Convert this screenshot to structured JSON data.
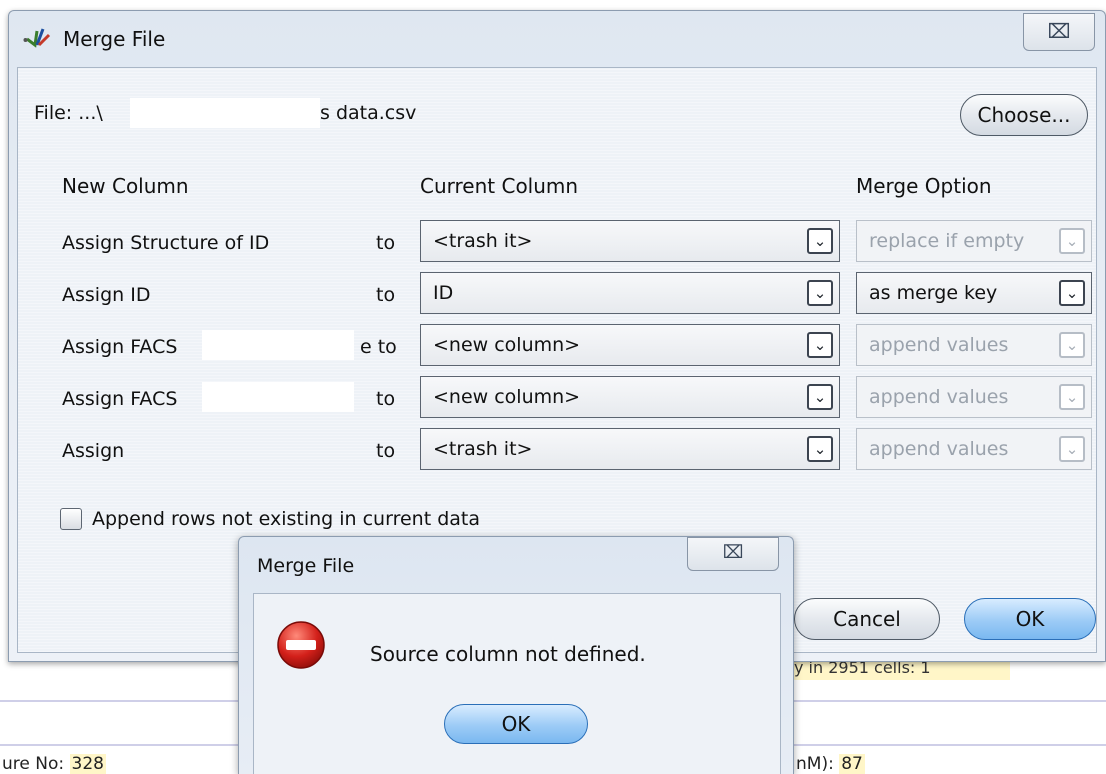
{
  "background": {
    "status_left_label": "ure No:",
    "status_left_value": "328",
    "status_right_label": "nM):",
    "status_right_value": "87",
    "cells_fragment": "y in 2951 cells: 1"
  },
  "dialog": {
    "title": "Merge File",
    "close_glyph": "⌧",
    "file_label": "File: ...\\",
    "file_suffix": "s data.csv",
    "choose_label": "Choose...",
    "headers": {
      "new_column": "New Column",
      "current_column": "Current Column",
      "merge_option": "Merge Option"
    },
    "rows": [
      {
        "label": "Assign Structure of ID",
        "to": "to",
        "current": "<trash it>",
        "option": "replace if empty",
        "option_enabled": false
      },
      {
        "label": "Assign ID",
        "to": "to",
        "current": "ID",
        "option": "as merge key",
        "option_enabled": true
      },
      {
        "label": "Assign FACS",
        "to": "e to",
        "current": "<new column>",
        "option": "append values",
        "option_enabled": false
      },
      {
        "label": "Assign FACS",
        "to": "to",
        "current": "<new column>",
        "option": "append values",
        "option_enabled": false
      },
      {
        "label": "Assign",
        "to": "to",
        "current": "<trash it>",
        "option": "append values",
        "option_enabled": false
      }
    ],
    "append_rows_label": "Append rows not existing in current data",
    "append_rows_checked": false,
    "cancel_label": "Cancel",
    "ok_label": "OK"
  },
  "error_popup": {
    "title": "Merge File",
    "close_glyph": "⌧",
    "icon": "error-icon",
    "message": "Source column not defined.",
    "ok_label": "OK"
  },
  "dropdown_glyph": "⌄"
}
